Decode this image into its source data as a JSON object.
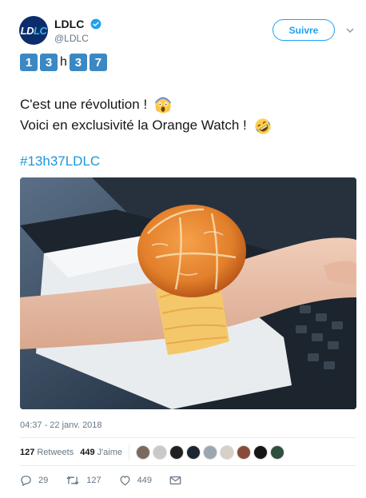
{
  "account": {
    "display_name": "LDLC",
    "handle": "@LDLC",
    "avatar_text_a": "LD",
    "avatar_text_b": "LC"
  },
  "header": {
    "follow_label": "Suivre"
  },
  "tweet": {
    "keycaps": [
      "1",
      "3",
      "h",
      "3",
      "7"
    ],
    "line1": "C'est une révolution !",
    "line2": "Voici en exclusivité la Orange Watch !",
    "hashtag": "#13h37LDLC",
    "timestamp": "04:37 - 22 janv. 2018"
  },
  "stats": {
    "retweets_count": "127",
    "retweets_label": "Retweets",
    "likes_count": "449",
    "likes_label": "J'aime"
  },
  "likers": [
    "#7a6a5e",
    "#c9c9c9",
    "#202020",
    "#1a2433",
    "#9aa6b0",
    "#d8d0c8",
    "#8a4a3a",
    "#151515",
    "#2f4f3f"
  ],
  "actions": {
    "replies": "29",
    "retweets": "127",
    "likes": "449"
  },
  "colors": {
    "brand_blue": "#1da1f2",
    "hashtag": "#1b95e0",
    "keycap": "#3b88c3"
  }
}
